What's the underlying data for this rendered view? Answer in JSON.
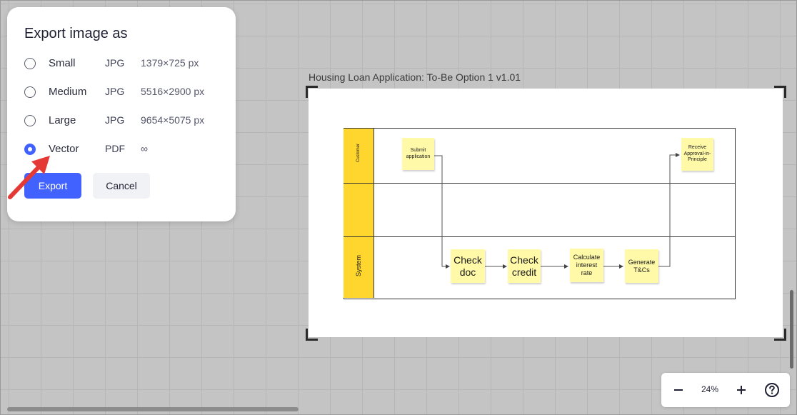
{
  "export_dialog": {
    "title": "Export image as",
    "options": [
      {
        "size": "Small",
        "format": "JPG",
        "dims": "1379×725 px",
        "selected": false
      },
      {
        "size": "Medium",
        "format": "JPG",
        "dims": "5516×2900 px",
        "selected": false
      },
      {
        "size": "Large",
        "format": "JPG",
        "dims": "9654×5075 px",
        "selected": false
      },
      {
        "size": "Vector",
        "format": "PDF",
        "dims": "∞",
        "selected": true
      }
    ],
    "export_label": "Export",
    "cancel_label": "Cancel"
  },
  "board": {
    "title": "Housing Loan Application: To-Be Option 1 v1.01",
    "lanes": [
      {
        "label": "Customer"
      },
      {
        "label": ""
      },
      {
        "label": "System"
      }
    ],
    "stickies": {
      "submit": "Submit application",
      "receive": "Receive Approval-in-Principle",
      "check_doc": "Check doc",
      "check_credit": "Check credit",
      "calc_rate": "Calculate interest rate",
      "gen_tcs": "Generate T&Cs"
    }
  },
  "zoom": {
    "level": "24%",
    "zoom_out_icon": "minus-icon",
    "zoom_in_icon": "plus-icon",
    "help_icon": "help-icon"
  },
  "colors": {
    "accent": "#4262ff",
    "lane_header": "#ffd62e",
    "sticky": "#fff9a8",
    "annotation_arrow": "#e53935"
  }
}
